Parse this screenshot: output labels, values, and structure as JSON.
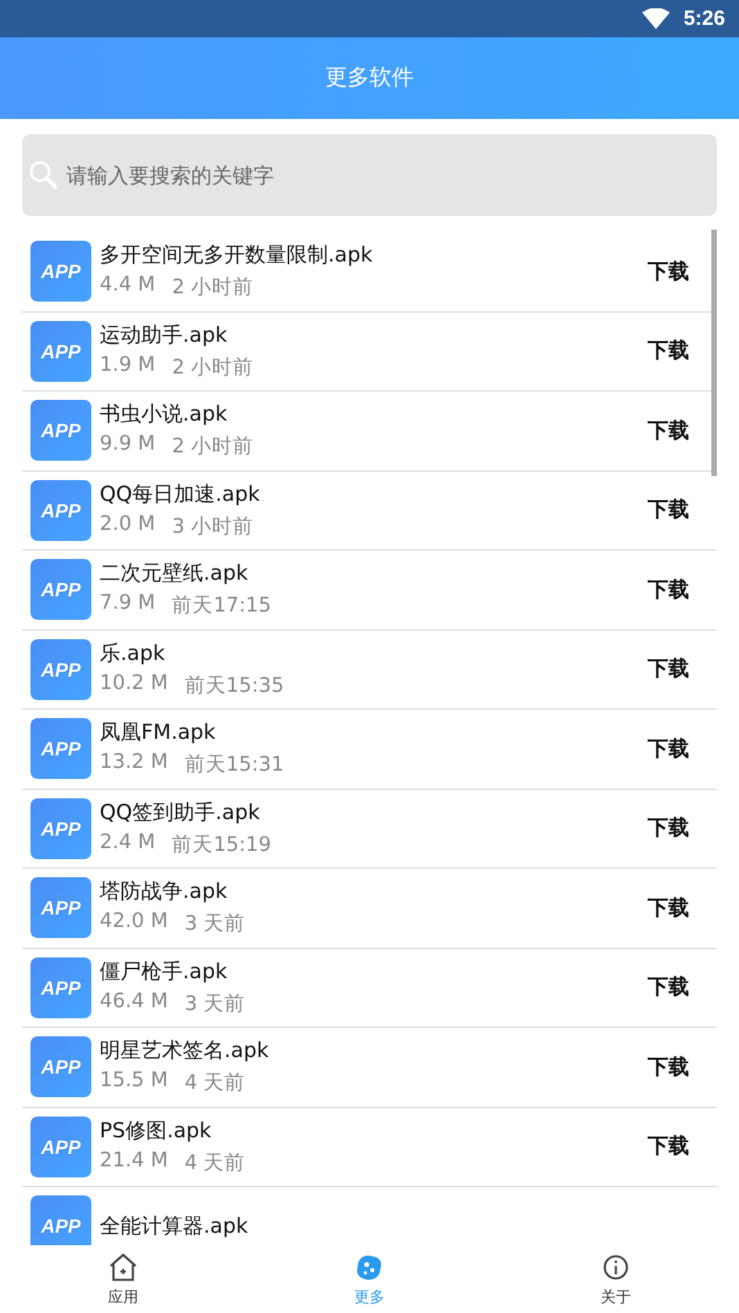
{
  "status_bar": {
    "time": "5:26"
  },
  "header": {
    "title": "更多软件"
  },
  "search": {
    "placeholder": "请输入要搜索的关键字"
  },
  "apps": [
    {
      "icon_text": "APP",
      "name": "多开空间无多开数量限制.apk",
      "size": "4.4 M",
      "time": "2 小时前",
      "action": "下载"
    },
    {
      "icon_text": "APP",
      "name": "运动助手.apk",
      "size": "1.9 M",
      "time": "2 小时前",
      "action": "下载"
    },
    {
      "icon_text": "APP",
      "name": "书虫小说.apk",
      "size": "9.9 M",
      "time": "2 小时前",
      "action": "下载"
    },
    {
      "icon_text": "APP",
      "name": "QQ每日加速.apk",
      "size": "2.0 M",
      "time": "3 小时前",
      "action": "下载"
    },
    {
      "icon_text": "APP",
      "name": "二次元壁纸.apk",
      "size": "7.9 M",
      "time": "前天17:15",
      "action": "下载"
    },
    {
      "icon_text": "APP",
      "name": "乐.apk",
      "size": "10.2 M",
      "time": "前天15:35",
      "action": "下载"
    },
    {
      "icon_text": "APP",
      "name": "凤凰FM.apk",
      "size": "13.2 M",
      "time": "前天15:31",
      "action": "下载"
    },
    {
      "icon_text": "APP",
      "name": "QQ签到助手.apk",
      "size": "2.4 M",
      "time": "前天15:19",
      "action": "下载"
    },
    {
      "icon_text": "APP",
      "name": "塔防战争.apk",
      "size": "42.0 M",
      "time": "3 天前",
      "action": "下载"
    },
    {
      "icon_text": "APP",
      "name": "僵尸枪手.apk",
      "size": "46.4 M",
      "time": "3 天前",
      "action": "下载"
    },
    {
      "icon_text": "APP",
      "name": "明星艺术签名.apk",
      "size": "15.5 M",
      "time": "4 天前",
      "action": "下载"
    },
    {
      "icon_text": "APP",
      "name": "PS修图.apk",
      "size": "21.4 M",
      "time": "4 天前",
      "action": "下载"
    },
    {
      "icon_text": "APP",
      "name": "全能计算器.apk"
    }
  ],
  "bottom_nav": [
    {
      "label": "应用",
      "kind": "home",
      "selected": false
    },
    {
      "label": "更多",
      "kind": "more",
      "selected": true
    },
    {
      "label": "关于",
      "kind": "about",
      "selected": false
    }
  ]
}
